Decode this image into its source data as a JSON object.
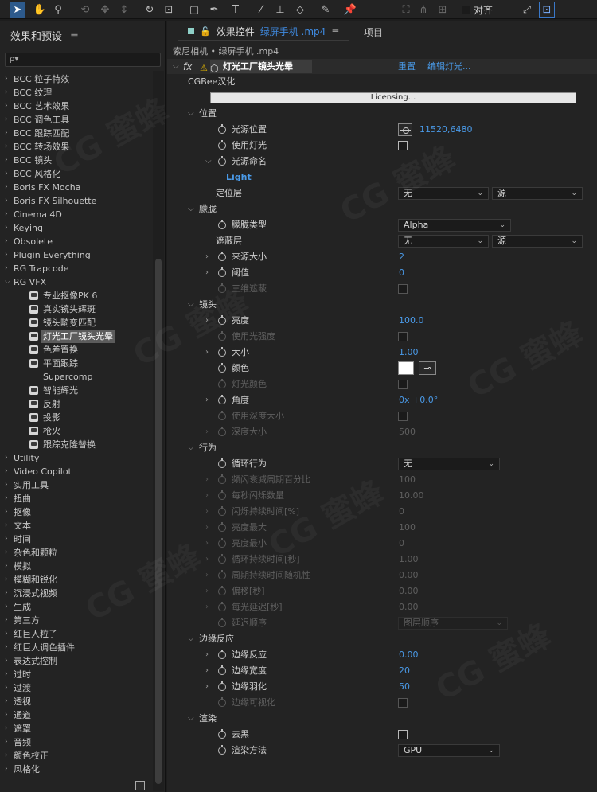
{
  "toolbar": {
    "snap_label": "对齐",
    "tools": [
      "selection",
      "hand",
      "zoom",
      "orbit",
      "pan",
      "dolly",
      "rotate",
      "anchor",
      "shape",
      "pen",
      "text",
      "brush",
      "stamp",
      "eraser",
      "roto",
      "puppet"
    ]
  },
  "left_panel": {
    "title": "效果和预设",
    "search_placeholder": "ρ▾",
    "items": [
      {
        "label": "BCC 粒子特效",
        "expanded": false
      },
      {
        "label": "BCC 纹理",
        "expanded": false
      },
      {
        "label": "BCC 艺术效果",
        "expanded": false
      },
      {
        "label": "BCC 调色工具",
        "expanded": false
      },
      {
        "label": "BCC 跟踪匹配",
        "expanded": false
      },
      {
        "label": "BCC 转场效果",
        "expanded": false
      },
      {
        "label": "BCC 镜头",
        "expanded": false
      },
      {
        "label": "BCC 风格化",
        "expanded": false
      },
      {
        "label": "Boris FX Mocha",
        "expanded": false
      },
      {
        "label": "Boris FX Silhouette",
        "expanded": false
      },
      {
        "label": "Cinema 4D",
        "expanded": false
      },
      {
        "label": "Keying",
        "expanded": false
      },
      {
        "label": "Obsolete",
        "expanded": false
      },
      {
        "label": "Plugin Everything",
        "expanded": false
      },
      {
        "label": "RG Trapcode",
        "expanded": false
      },
      {
        "label": "RG VFX",
        "expanded": true
      }
    ],
    "children": [
      {
        "label": "专业抠像PK 6",
        "icon": true
      },
      {
        "label": "真实镜头辉斑",
        "icon": true
      },
      {
        "label": "镜头畸变匹配",
        "icon": true
      },
      {
        "label": "灯光工厂镜头光晕",
        "icon": true,
        "selected": true
      },
      {
        "label": "色差置换",
        "icon": true
      },
      {
        "label": "平面跟踪",
        "icon": true
      },
      {
        "label": "Supercomp",
        "icon": false
      },
      {
        "label": "智能辉光",
        "icon": true
      },
      {
        "label": "反射",
        "icon": true
      },
      {
        "label": "投影",
        "icon": true
      },
      {
        "label": "枪火",
        "icon": true
      },
      {
        "label": "跟踪克隆替换",
        "icon": true
      }
    ],
    "items_after": [
      "Utility",
      "Video Copilot",
      "实用工具",
      "扭曲",
      "抠像",
      "文本",
      "时间",
      "杂色和颗粒",
      "模拟",
      "模糊和锐化",
      "沉浸式视频",
      "生成",
      "第三方",
      "红巨人粒子",
      "红巨人调色插件",
      "表达式控制",
      "过时",
      "过渡",
      "透视",
      "通道",
      "遮罩",
      "音频",
      "颜色校正",
      "风格化"
    ]
  },
  "right_panel": {
    "tab_label": "效果控件",
    "tab_clip": "绿屏手机 .mp4",
    "tab_project": "项目",
    "comp_line": "索尼相机 • 绿屏手机 .mp4",
    "effect": {
      "fx": "fx",
      "name": "灯光工厂镜头光晕",
      "reset": "重置",
      "edit": "编辑灯光..."
    },
    "cgbee": "CGBee汉化",
    "licensing": "Licensing...",
    "groups": {
      "position": "位置",
      "mask": "朦胧",
      "lens": "镜头",
      "behavior": "行为",
      "edge": "边缘反应",
      "render": "渲染"
    },
    "params": {
      "light_pos": {
        "name": "光源位置",
        "value": "11520,6480"
      },
      "use_lights": {
        "name": "使用灯光"
      },
      "light_naming": {
        "name": "光源命名"
      },
      "light_value": "Light",
      "locate_layer": {
        "name": "定位层",
        "dd1": "无",
        "dd2": "源"
      },
      "mask_type": {
        "name": "朦胧类型",
        "value": "Alpha"
      },
      "mask_layer": {
        "name": "遮蔽层",
        "dd1": "无",
        "dd2": "源"
      },
      "source_size": {
        "name": "来源大小",
        "value": "2"
      },
      "threshold": {
        "name": "阈值",
        "value": "0"
      },
      "3d_mask": {
        "name": "三维遮蔽"
      },
      "brightness": {
        "name": "亮度",
        "value": "100.0"
      },
      "use_light_intensity": {
        "name": "使用光强度"
      },
      "scale": {
        "name": "大小",
        "value": "1.00"
      },
      "color": {
        "name": "颜色"
      },
      "light_color": {
        "name": "灯光颜色"
      },
      "angle": {
        "name": "角度",
        "value": "0x +0.0°"
      },
      "use_depth_size": {
        "name": "使用深度大小"
      },
      "depth_size": {
        "name": "深度大小",
        "value": "500"
      },
      "loop": {
        "name": "循环行为",
        "value": "无"
      },
      "flicker_pct": {
        "name": "频闪衰减周期百分比",
        "value": "100"
      },
      "flicker_count": {
        "name": "每秒闪烁数量",
        "value": "10.00"
      },
      "flicker_dur": {
        "name": "闪烁持续时间[%]",
        "value": "0"
      },
      "bright_max": {
        "name": "亮度最大",
        "value": "100"
      },
      "bright_min": {
        "name": "亮度最小",
        "value": "0"
      },
      "cycle_dur": {
        "name": "循环持续时间[秒]",
        "value": "1.00"
      },
      "cycle_rand": {
        "name": "周期持续时间随机性",
        "value": "0.00"
      },
      "offset": {
        "name": "偏移[秒]",
        "value": "0.00"
      },
      "light_delay": {
        "name": "每光延迟[秒]",
        "value": "0.00"
      },
      "delay_order": {
        "name": "延迟顺序",
        "value": "图层顺序"
      },
      "edge_react": {
        "name": "边缘反应",
        "value": "0.00"
      },
      "edge_width": {
        "name": "边缘宽度",
        "value": "20"
      },
      "edge_feather": {
        "name": "边缘羽化",
        "value": "50"
      },
      "edge_visual": {
        "name": "边缘可视化"
      },
      "remove_black": {
        "name": "去黑"
      },
      "render_method": {
        "name": "渲染方法",
        "value": "GPU"
      }
    }
  },
  "watermark": "CG 蜜蜂"
}
